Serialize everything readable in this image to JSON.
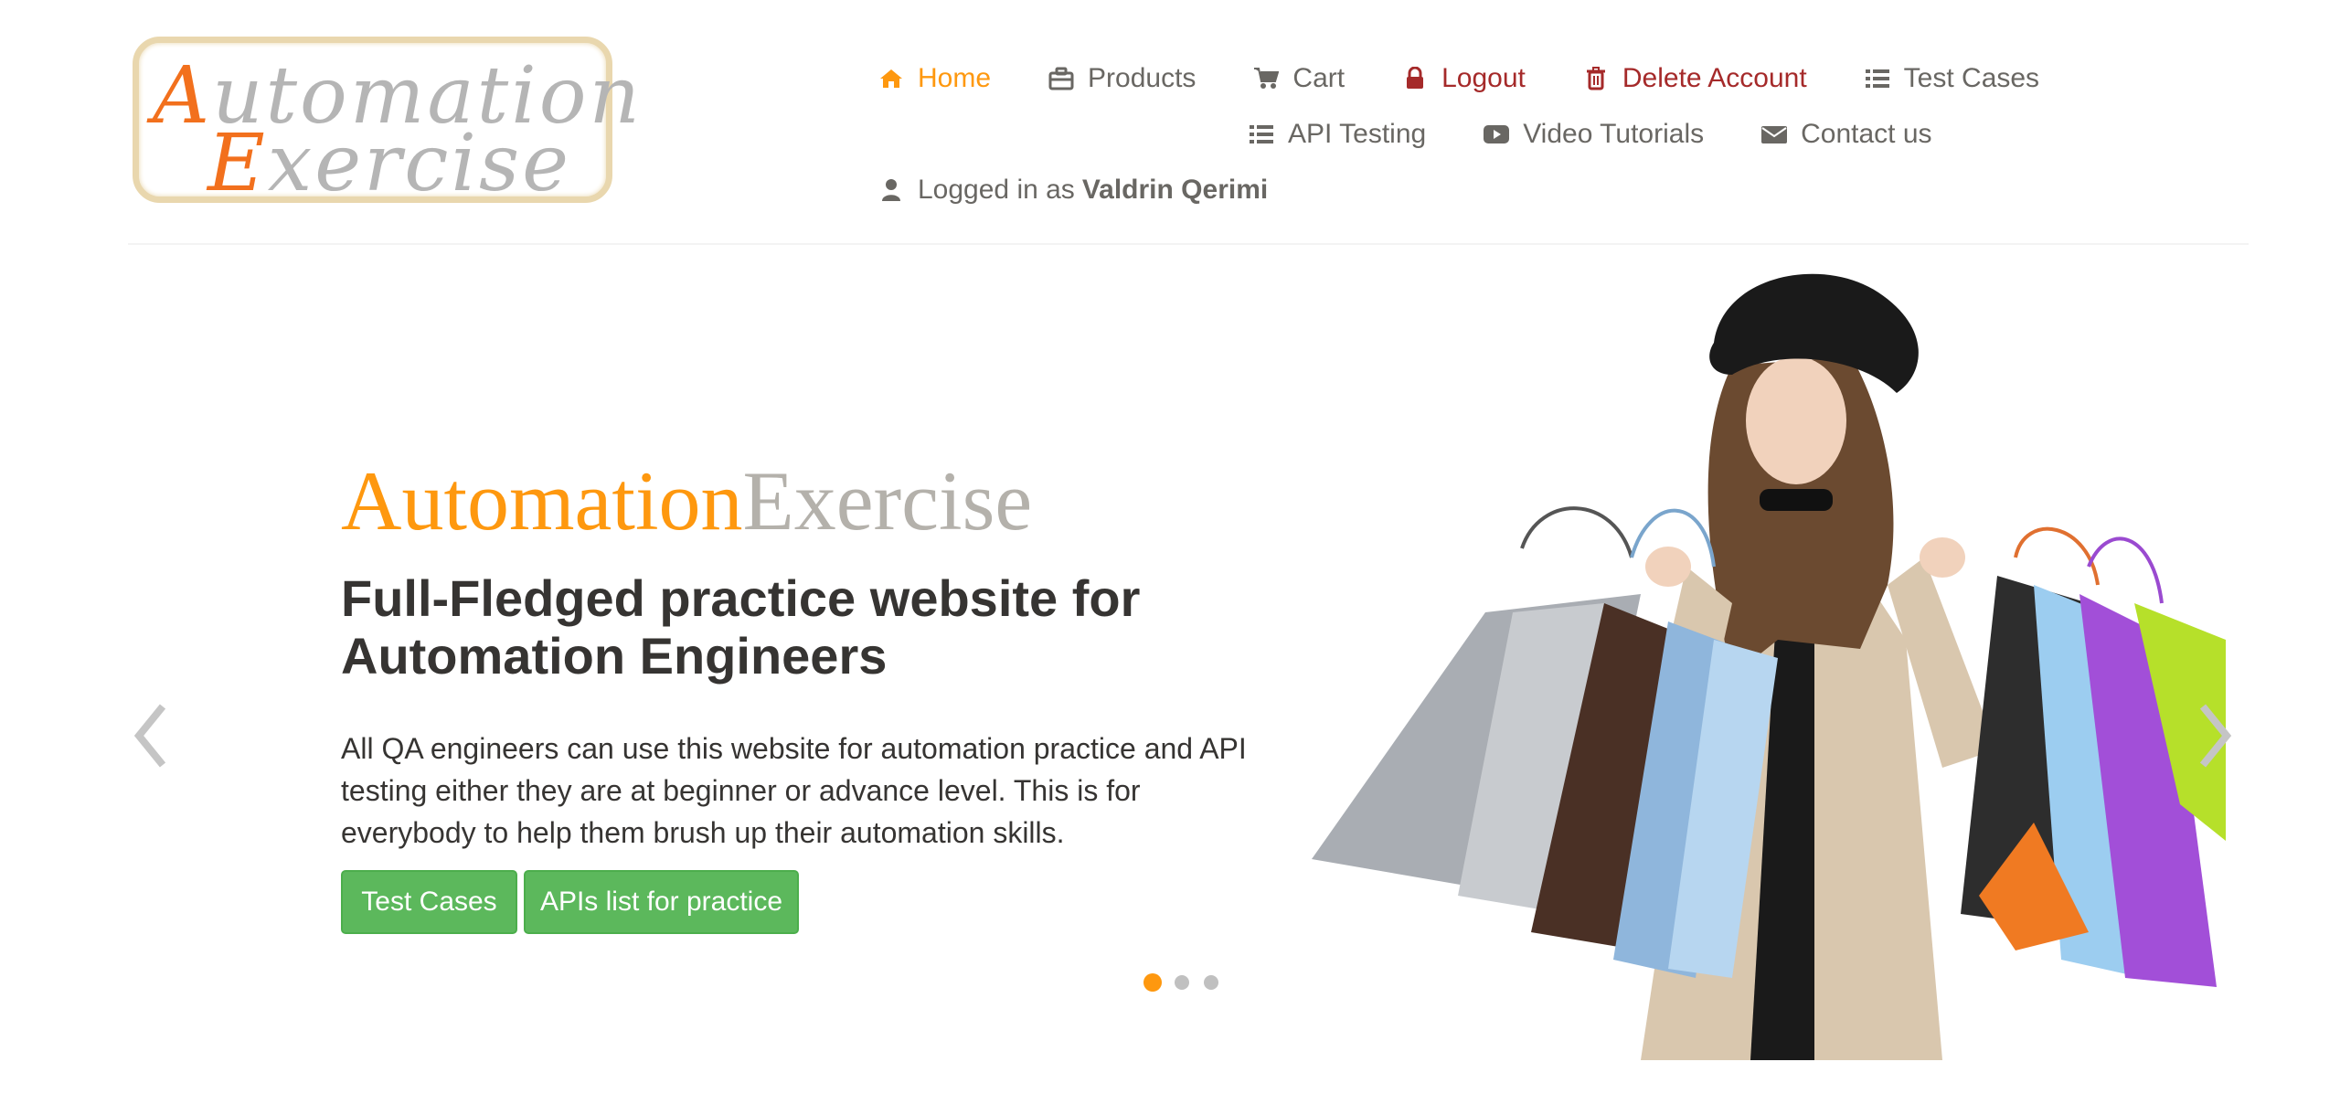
{
  "logo": {
    "line1_cap": "A",
    "line1_rest": "utomation",
    "line2_cap": "E",
    "line2_rest": "xercise"
  },
  "nav": {
    "home": "Home",
    "products": "Products",
    "cart": "Cart",
    "logout": "Logout",
    "delete_account": "Delete Account",
    "test_cases": "Test Cases",
    "api_testing": "API Testing",
    "video_tutorials": "Video Tutorials",
    "contact_us": "Contact us",
    "logged_in_prefix": "Logged in as",
    "logged_in_user": "Valdrin Qerimi"
  },
  "hero": {
    "title_part1": "Automation",
    "title_part2": "Exercise",
    "subtitle": "Full-Fledged practice website for Automation Engineers",
    "description": "All QA engineers can use this website for automation practice and API testing either they are at beginner or advance level. This is for everybody to help them brush up their automation skills.",
    "btn_test_cases": "Test Cases",
    "btn_apis": "APIs list for practice"
  },
  "carousel": {
    "slides": 3,
    "active_index": 0
  },
  "colors": {
    "accent": "#fe980f",
    "danger": "#a52a2a",
    "button": "#5cb85c",
    "text": "#696763"
  },
  "icons": {
    "home": "home-icon",
    "products": "briefcase-icon",
    "cart": "cart-icon",
    "logout": "lock-icon",
    "delete": "trash-icon",
    "test_cases": "list-icon",
    "api_testing": "list-icon",
    "video": "youtube-icon",
    "contact": "envelope-icon",
    "user": "user-icon"
  }
}
